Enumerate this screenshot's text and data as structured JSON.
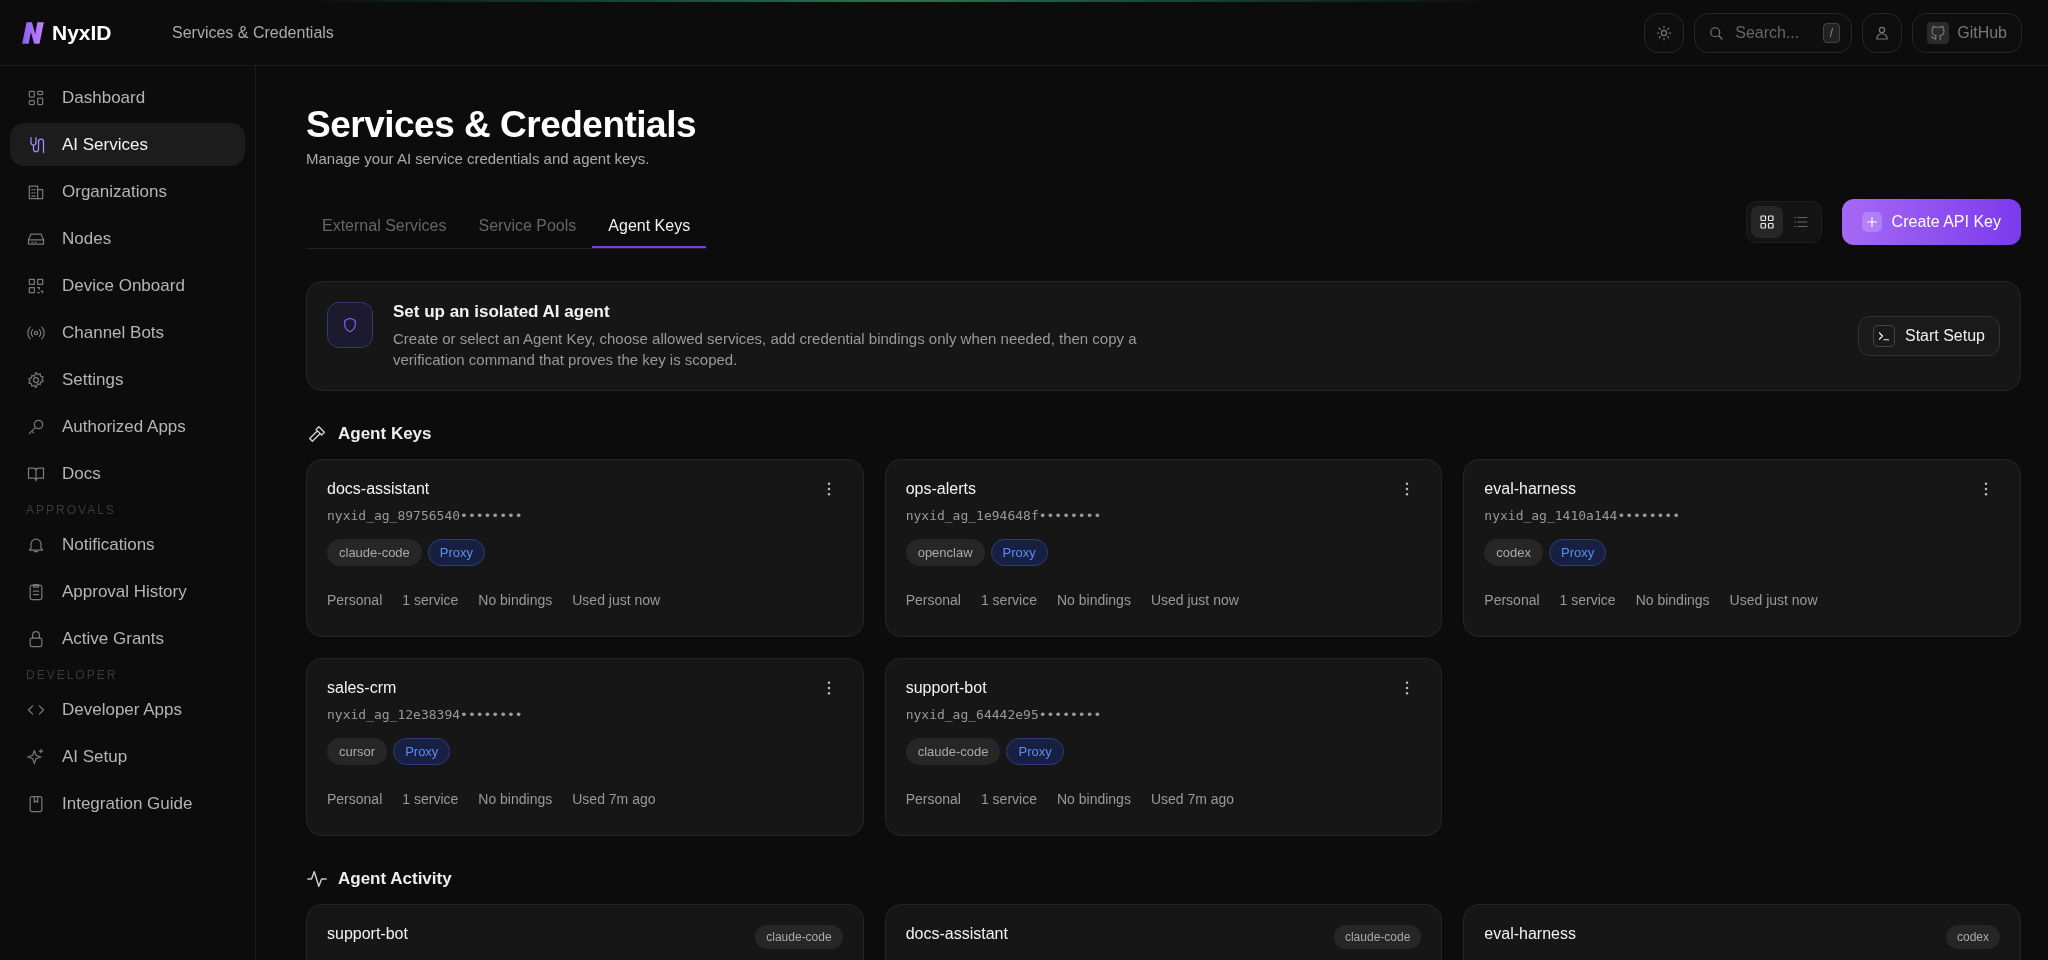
{
  "brand": {
    "name": "NyxID"
  },
  "header": {
    "breadcrumb": "Services & Credentials",
    "search": {
      "placeholder": "Search...",
      "shortcut": "/"
    },
    "github": "GitHub"
  },
  "sidebar": {
    "sections": [
      {
        "items": [
          {
            "label": "Dashboard",
            "selected": false
          },
          {
            "label": "AI Services",
            "selected": true
          },
          {
            "label": "Organizations",
            "selected": false
          },
          {
            "label": "Nodes",
            "selected": false
          },
          {
            "label": "Device Onboard",
            "selected": false
          },
          {
            "label": "Channel Bots",
            "selected": false
          },
          {
            "label": "Settings",
            "selected": false
          },
          {
            "label": "Authorized Apps",
            "selected": false
          },
          {
            "label": "Docs",
            "selected": false
          }
        ]
      },
      {
        "title": "APPROVALS",
        "items": [
          {
            "label": "Notifications",
            "selected": false
          },
          {
            "label": "Approval History",
            "selected": false
          },
          {
            "label": "Active Grants",
            "selected": false
          }
        ]
      },
      {
        "title": "DEVELOPER",
        "items": [
          {
            "label": "Developer Apps",
            "selected": false
          },
          {
            "label": "AI Setup",
            "selected": false
          },
          {
            "label": "Integration Guide",
            "selected": false
          }
        ]
      }
    ]
  },
  "page": {
    "title": "Services & Credentials",
    "subtitle": "Manage your AI service credentials and agent keys."
  },
  "tabs": [
    {
      "label": "External Services",
      "selected": false
    },
    {
      "label": "Service Pools",
      "selected": false
    },
    {
      "label": "Agent Keys",
      "selected": true
    }
  ],
  "view_toggle": [
    {
      "kind": "grid",
      "selected": true
    },
    {
      "kind": "list",
      "selected": false
    }
  ],
  "create_button": "Create API Key",
  "banner": {
    "title": "Set up an isolated AI agent",
    "text": "Create or select an Agent Key, choose allowed services, add credential bindings only when needed, then copy a verification command that proves the key is scoped.",
    "button": "Start Setup"
  },
  "agent_keys": {
    "heading": "Agent Keys",
    "cards": [
      {
        "name": "docs-assistant",
        "key": "nyxid_ag_89756540••••••••",
        "tags": [
          {
            "label": "claude-code",
            "kind": "client"
          },
          {
            "label": "Proxy",
            "kind": "mode"
          }
        ],
        "meta": [
          "Personal",
          "1 service",
          "No bindings",
          "Used just now"
        ]
      },
      {
        "name": "ops-alerts",
        "key": "nyxid_ag_1e94648f••••••••",
        "tags": [
          {
            "label": "openclaw",
            "kind": "client"
          },
          {
            "label": "Proxy",
            "kind": "mode"
          }
        ],
        "meta": [
          "Personal",
          "1 service",
          "No bindings",
          "Used just now"
        ]
      },
      {
        "name": "eval-harness",
        "key": "nyxid_ag_1410a144••••••••",
        "tags": [
          {
            "label": "codex",
            "kind": "client"
          },
          {
            "label": "Proxy",
            "kind": "mode"
          }
        ],
        "meta": [
          "Personal",
          "1 service",
          "No bindings",
          "Used just now"
        ]
      },
      {
        "name": "sales-crm",
        "key": "nyxid_ag_12e38394••••••••",
        "tags": [
          {
            "label": "cursor",
            "kind": "client"
          },
          {
            "label": "Proxy",
            "kind": "mode"
          }
        ],
        "meta": [
          "Personal",
          "1 service",
          "No bindings",
          "Used 7m ago"
        ]
      },
      {
        "name": "support-bot",
        "key": "nyxid_ag_64442e95••••••••",
        "tags": [
          {
            "label": "claude-code",
            "kind": "client"
          },
          {
            "label": "Proxy",
            "kind": "mode"
          }
        ],
        "meta": [
          "Personal",
          "1 service",
          "No bindings",
          "Used 7m ago"
        ]
      }
    ]
  },
  "agent_activity": {
    "heading": "Agent Activity",
    "cards": [
      {
        "name": "support-bot",
        "client": "claude-code"
      },
      {
        "name": "docs-assistant",
        "client": "claude-code"
      },
      {
        "name": "eval-harness",
        "client": "codex"
      }
    ]
  }
}
